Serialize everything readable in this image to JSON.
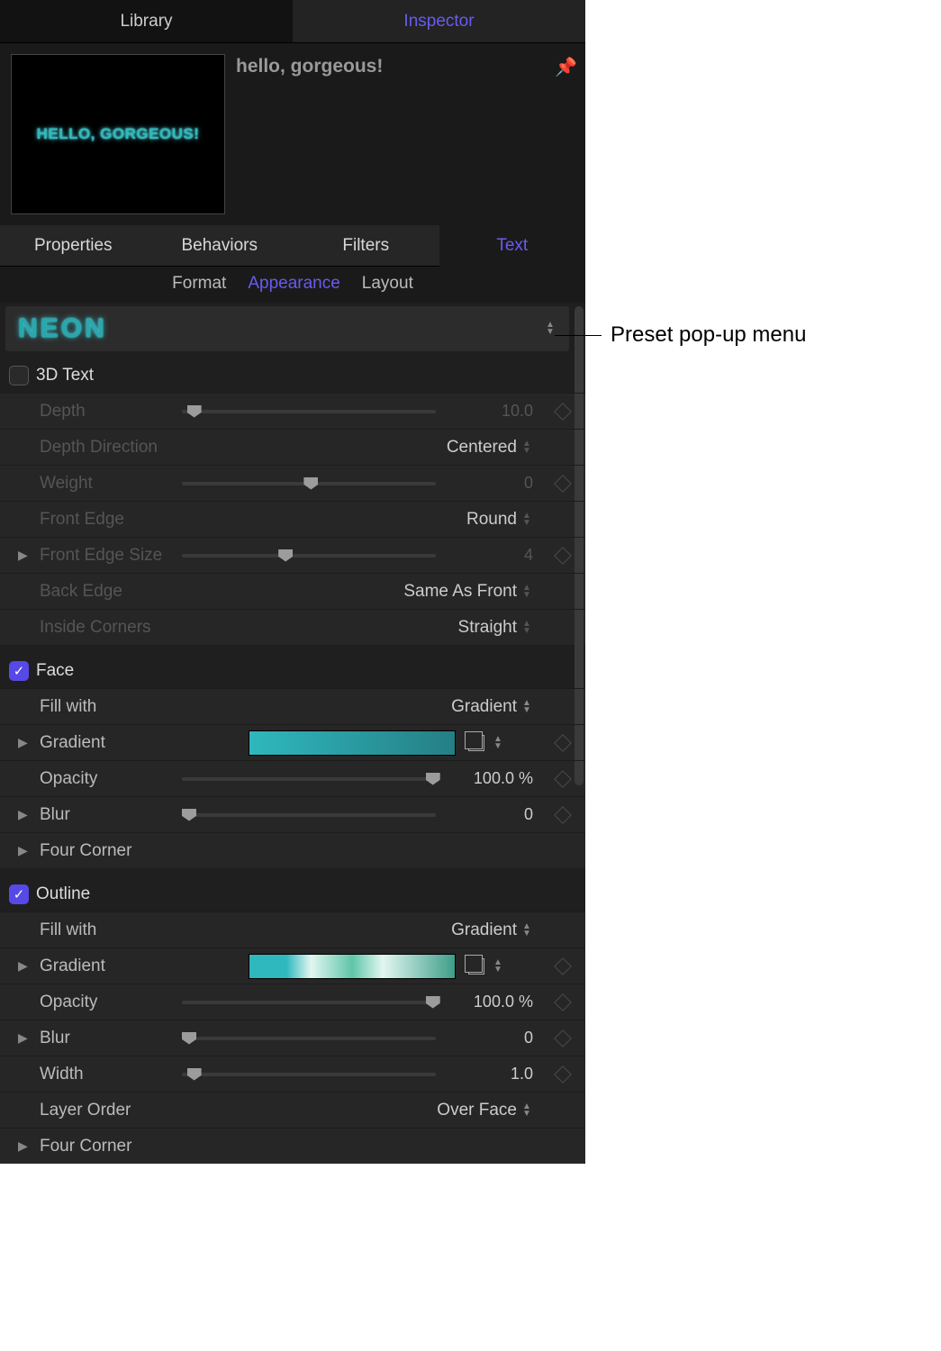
{
  "topTabs": {
    "library": "Library",
    "inspector": "Inspector"
  },
  "preview": {
    "thumbText": "HELLO, GORGEOUS!",
    "title": "hello, gorgeous!"
  },
  "subTabs": {
    "properties": "Properties",
    "behaviors": "Behaviors",
    "filters": "Filters",
    "text": "Text"
  },
  "textMode": {
    "format": "Format",
    "appearance": "Appearance",
    "layout": "Layout"
  },
  "preset": {
    "label": "NEON"
  },
  "threeD": {
    "header": "3D Text",
    "depth": {
      "label": "Depth",
      "value": "10.0"
    },
    "depthDirection": {
      "label": "Depth Direction",
      "value": "Centered"
    },
    "weight": {
      "label": "Weight",
      "value": "0"
    },
    "frontEdge": {
      "label": "Front Edge",
      "value": "Round"
    },
    "frontEdgeSize": {
      "label": "Front Edge Size",
      "value": "4"
    },
    "backEdge": {
      "label": "Back Edge",
      "value": "Same As Front"
    },
    "insideCorners": {
      "label": "Inside Corners",
      "value": "Straight"
    }
  },
  "face": {
    "header": "Face",
    "fillWith": {
      "label": "Fill with",
      "value": "Gradient"
    },
    "gradient": {
      "label": "Gradient"
    },
    "opacity": {
      "label": "Opacity",
      "value": "100.0",
      "unit": "%"
    },
    "blur": {
      "label": "Blur",
      "value": "0"
    },
    "fourCorner": {
      "label": "Four Corner"
    }
  },
  "outline": {
    "header": "Outline",
    "fillWith": {
      "label": "Fill with",
      "value": "Gradient"
    },
    "gradient": {
      "label": "Gradient"
    },
    "opacity": {
      "label": "Opacity",
      "value": "100.0",
      "unit": "%"
    },
    "blur": {
      "label": "Blur",
      "value": "0"
    },
    "width": {
      "label": "Width",
      "value": "1.0"
    },
    "layerOrder": {
      "label": "Layer Order",
      "value": "Over Face"
    },
    "fourCorner": {
      "label": "Four Corner"
    }
  },
  "annotation": "Preset pop-up menu"
}
